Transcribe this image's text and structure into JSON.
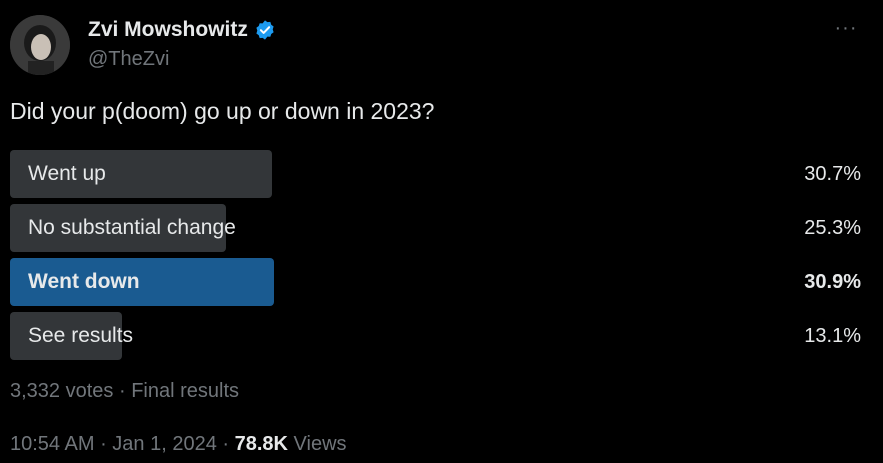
{
  "author": {
    "display_name": "Zvi Mowshowitz",
    "handle": "@TheZvi",
    "verified": true
  },
  "more_menu": {
    "icon": "more-horizontal-icon",
    "label": "···"
  },
  "tweet_text": "Did your p(doom) go up or down in 2023?",
  "poll": {
    "options": [
      {
        "label": "Went up",
        "percent_text": "30.7%",
        "percent": 30.7,
        "winner": false
      },
      {
        "label": "No substantial change",
        "percent_text": "25.3%",
        "percent": 25.3,
        "winner": false
      },
      {
        "label": "Went down",
        "percent_text": "30.9%",
        "percent": 30.9,
        "winner": true
      },
      {
        "label": "See results",
        "percent_text": "13.1%",
        "percent": 13.1,
        "winner": false
      }
    ],
    "votes": "3,332 votes",
    "separator": " · ",
    "status": "Final results"
  },
  "meta": {
    "time": "10:54 AM",
    "separator": " · ",
    "date": "Jan 1, 2024",
    "views_count": "78.8K",
    "views_label": " Views"
  },
  "colors": {
    "background": "#000000",
    "text": "#e7e9ea",
    "muted": "#71767b",
    "bar": "#333639",
    "winner_bar": "#1a5b91",
    "verified": "#1d9bf0"
  }
}
